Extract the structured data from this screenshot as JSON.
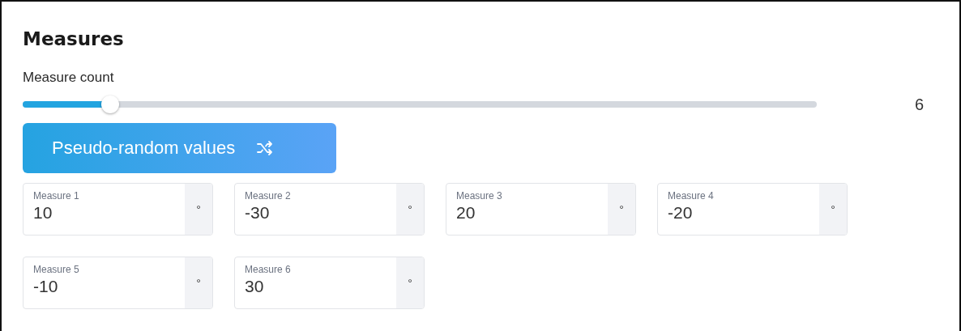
{
  "title": "Measures",
  "slider": {
    "label": "Measure count",
    "level": 0.11,
    "reading": "6"
  },
  "button": {
    "label": "Pseudo-random values"
  },
  "fields": [
    {
      "label": "Measure 1",
      "value": "10",
      "unit": "°"
    },
    {
      "label": "Measure 2",
      "value": "-30",
      "unit": "°"
    },
    {
      "label": "Measure 3",
      "value": "20",
      "unit": "°"
    },
    {
      "label": "Measure 4",
      "value": "-20",
      "unit": "°"
    },
    {
      "label": "Measure 5",
      "value": "-10",
      "unit": "°"
    },
    {
      "label": "Measure 6",
      "value": "30",
      "unit": "°"
    }
  ]
}
